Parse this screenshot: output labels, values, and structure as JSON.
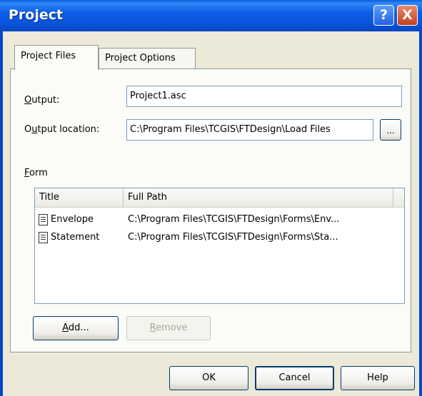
{
  "window": {
    "title": "Project",
    "help_glyph": "?",
    "close_glyph": "X"
  },
  "tabs": [
    {
      "label": "Project Files",
      "active": true
    },
    {
      "label": "Project Options",
      "active": false
    }
  ],
  "output": {
    "label_prefix": "",
    "label_mnemonic": "O",
    "label_rest": "utput:",
    "value": "Project1.asc"
  },
  "output_location": {
    "label_prefix": "O",
    "label_mnemonic": "u",
    "label_rest": "tput location:",
    "value": "C:\\Program Files\\TCGIS\\FTDesign\\Load Files",
    "browse_label": "..."
  },
  "form": {
    "label_mnemonic": "F",
    "label_rest": "orm",
    "columns": [
      "Title",
      "Full Path"
    ],
    "rows": [
      {
        "title": "Envelope",
        "path": "C:\\Program Files\\TCGIS\\FTDesign\\Forms\\Env...",
        "icon": "document-icon"
      },
      {
        "title": "Statement",
        "path": "C:\\Program Files\\TCGIS\\FTDesign\\Forms\\Sta...",
        "icon": "document-icon"
      }
    ],
    "add": {
      "mnemonic": "A",
      "rest": "dd..."
    },
    "remove": {
      "mnemonic": "R",
      "rest": "emove",
      "enabled": false
    }
  },
  "buttons": {
    "ok": "OK",
    "cancel": "Cancel",
    "help": "Help"
  },
  "colors": {
    "titlebar": "#0a56dd",
    "window_bg": "#ece9d8",
    "close_button": "#c2401c"
  }
}
